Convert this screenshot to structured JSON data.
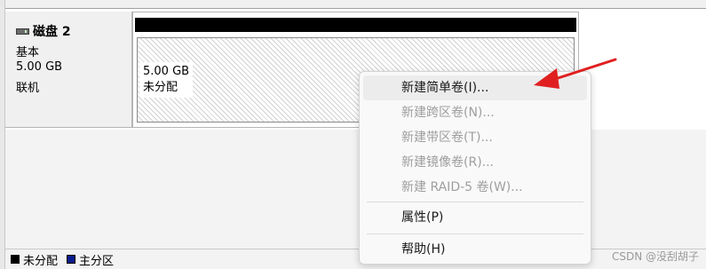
{
  "disk": {
    "name": "磁盘 2",
    "type": "基本",
    "size": "5.00 GB",
    "status": "联机"
  },
  "volume": {
    "size": "5.00 GB",
    "status": "未分配"
  },
  "context_menu": {
    "items": [
      {
        "label": "新建简单卷(I)...",
        "enabled": true
      },
      {
        "label": "新建跨区卷(N)...",
        "enabled": false
      },
      {
        "label": "新建带区卷(T)...",
        "enabled": false
      },
      {
        "label": "新建镜像卷(R)...",
        "enabled": false
      },
      {
        "label": "新建 RAID-5 卷(W)...",
        "enabled": false
      },
      {
        "label": "属性(P)",
        "enabled": true
      },
      {
        "label": "帮助(H)",
        "enabled": true
      }
    ]
  },
  "legend": {
    "items": [
      {
        "label": "未分配",
        "color": "#000000"
      },
      {
        "label": "主分区",
        "color": "#0a1d8c"
      }
    ]
  },
  "watermark": "CSDN @没刮胡子",
  "annotation": {
    "arrow_color": "#e02020"
  }
}
